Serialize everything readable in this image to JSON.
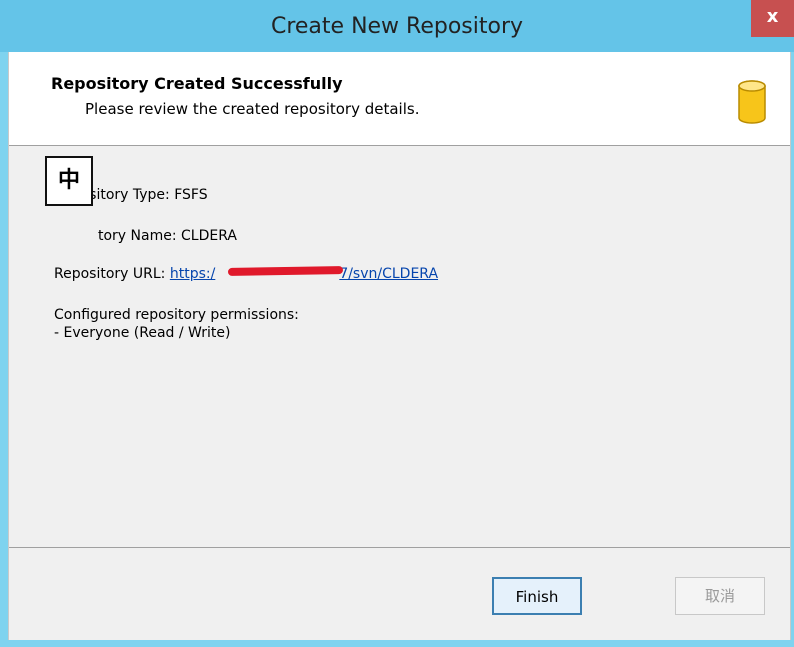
{
  "window": {
    "title": "Create New Repository",
    "close_label": "x"
  },
  "header": {
    "title": "Repository Created Successfully",
    "subtitle": "Please review the created repository details.",
    "icon": "database-icon"
  },
  "details": {
    "type_line": "Repository Type: FSFS",
    "name_line": "tory Name: CLDERA",
    "url_label": "Repository URL: ",
    "url_link": "https:/",
    "url_suffix": "7/svn/CLDERA",
    "permissions_heading": "Configured repository permissions:",
    "permissions_item": "- Everyone (Read / Write)"
  },
  "ime_indicator": "中",
  "buttons": {
    "finish": "Finish",
    "cancel": "取消"
  },
  "colors": {
    "titlebar": "#64c4e8",
    "close": "#c75050",
    "link": "#0645ad",
    "redaction": "#e0192b"
  }
}
